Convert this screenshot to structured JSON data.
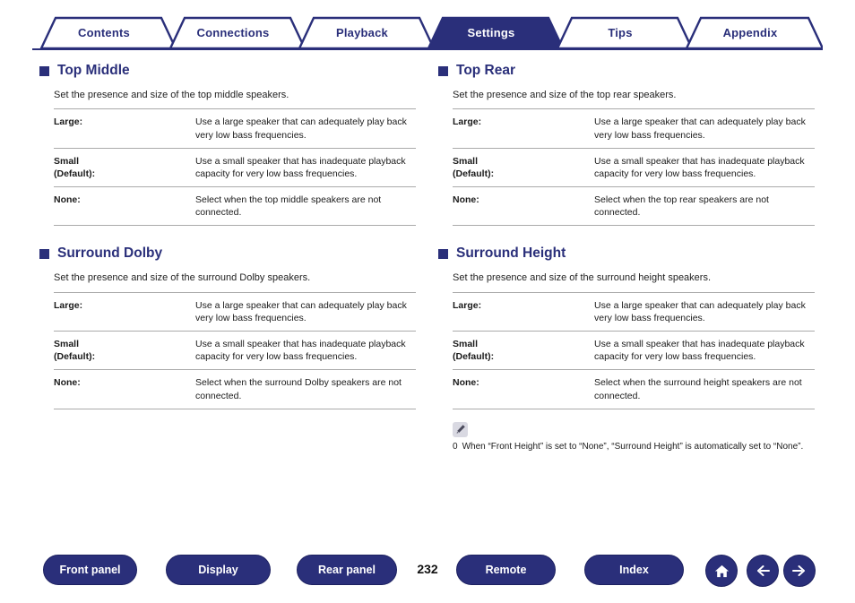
{
  "tabs": [
    {
      "label": "Contents",
      "active": false
    },
    {
      "label": "Connections",
      "active": false
    },
    {
      "label": "Playback",
      "active": false
    },
    {
      "label": "Settings",
      "active": true
    },
    {
      "label": "Tips",
      "active": false
    },
    {
      "label": "Appendix",
      "active": false
    }
  ],
  "sections": [
    {
      "title": "Top Middle",
      "description": "Set the presence and size of the top middle speakers.",
      "rows": [
        {
          "term": "Large:",
          "sub": "",
          "desc": "Use a large speaker that can adequately play back very low bass frequencies."
        },
        {
          "term": "Small",
          "sub": "(Default):",
          "desc": "Use a small speaker that has inadequate playback capacity for very low bass frequencies."
        },
        {
          "term": "None:",
          "sub": "",
          "desc": "Select when the top middle speakers are not connected."
        }
      ]
    },
    {
      "title": "Top Rear",
      "description": "Set the presence and size of the top rear speakers.",
      "rows": [
        {
          "term": "Large:",
          "sub": "",
          "desc": "Use a large speaker that can adequately play back very low bass frequencies."
        },
        {
          "term": "Small",
          "sub": "(Default):",
          "desc": "Use a small speaker that has inadequate playback capacity for very low bass frequencies."
        },
        {
          "term": "None:",
          "sub": "",
          "desc": "Select when the top rear speakers are not connected."
        }
      ]
    },
    {
      "title": "Surround Dolby",
      "description": "Set the presence and size of the surround Dolby speakers.",
      "rows": [
        {
          "term": "Large:",
          "sub": "",
          "desc": "Use a large speaker that can adequately play back very low bass frequencies."
        },
        {
          "term": "Small",
          "sub": "(Default):",
          "desc": "Use a small speaker that has inadequate playback capacity for very low bass frequencies."
        },
        {
          "term": "None:",
          "sub": "",
          "desc": "Select when the surround Dolby speakers are not connected."
        }
      ]
    },
    {
      "title": "Surround Height",
      "description": "Set the presence and size of the surround height speakers.",
      "rows": [
        {
          "term": "Large:",
          "sub": "",
          "desc": "Use a large speaker that can adequately play back very low bass frequencies."
        },
        {
          "term": "Small",
          "sub": "(Default):",
          "desc": "Use a small speaker that has inadequate playback capacity for very low bass frequencies."
        },
        {
          "term": "None:",
          "sub": "",
          "desc": "Select when the surround height speakers are not connected."
        }
      ]
    }
  ],
  "note": {
    "bullet": "0",
    "text": "When “Front Height” is set to “None”, “Surround Height” is automatically set to “None”."
  },
  "bottom": {
    "buttons": [
      {
        "label": "Front panel"
      },
      {
        "label": "Display"
      },
      {
        "label": "Rear panel"
      },
      {
        "label": "Remote"
      },
      {
        "label": "Index"
      }
    ],
    "page": "232"
  },
  "colors": {
    "brand": "#2a2f7a",
    "rule": "#aaaaaa"
  }
}
